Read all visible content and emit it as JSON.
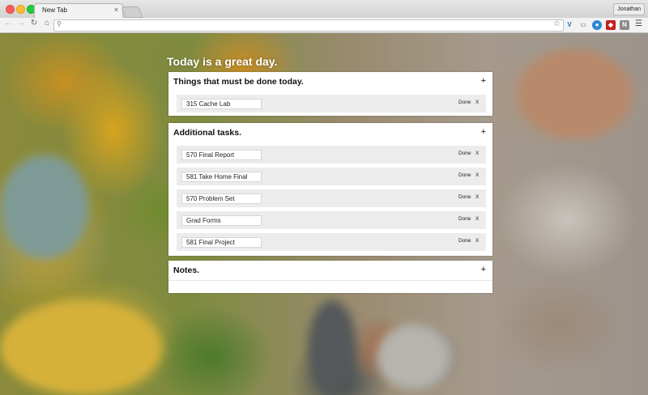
{
  "browser": {
    "tab_title": "New Tab",
    "tab_close": "×",
    "profile_name": "Jonathan",
    "omnibox_value": "",
    "icons": {
      "back": "back-arrow-icon",
      "forward": "forward-arrow-icon",
      "reload": "reload-icon",
      "home": "home-icon",
      "search": "search-icon",
      "star": "star-icon",
      "menu": "hamburger-menu-icon"
    }
  },
  "page": {
    "heading": "Today is a great day."
  },
  "sections": {
    "today": {
      "title": "Things that must be done today.",
      "add_label": "+",
      "tasks": [
        {
          "text": "315 Cache Lab",
          "done_label": "Done",
          "remove_label": "X"
        }
      ]
    },
    "additional": {
      "title": "Additional tasks.",
      "add_label": "+",
      "tasks": [
        {
          "text": "570 Final Report",
          "done_label": "Done",
          "remove_label": "X"
        },
        {
          "text": "581 Take Home Final",
          "done_label": "Done",
          "remove_label": "X"
        },
        {
          "text": "570 Problem Set",
          "done_label": "Done",
          "remove_label": "X"
        },
        {
          "text": "Grad Forms",
          "done_label": "Done",
          "remove_label": "X"
        },
        {
          "text": "581 Final Project",
          "done_label": "Done",
          "remove_label": "X"
        }
      ]
    },
    "notes": {
      "title": "Notes.",
      "add_label": "+"
    }
  }
}
